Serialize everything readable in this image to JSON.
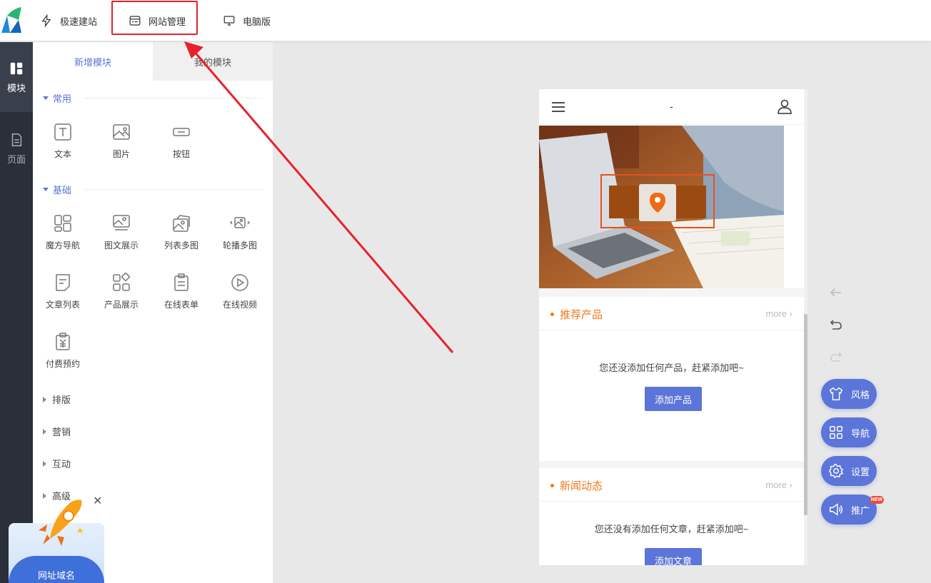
{
  "topbar": {
    "items": [
      {
        "label": "极速建站"
      },
      {
        "label": "网站管理"
      },
      {
        "label": "电脑版"
      }
    ]
  },
  "rail": {
    "items": [
      {
        "label": "模块"
      },
      {
        "label": "页面"
      }
    ]
  },
  "panel": {
    "tabs": [
      {
        "label": "新增模块"
      },
      {
        "label": "我的模块"
      }
    ],
    "sections": [
      {
        "title": "常用",
        "modules": [
          "文本",
          "图片",
          "按钮"
        ]
      },
      {
        "title": "基础",
        "modules": [
          "魔方导航",
          "图文展示",
          "列表多图",
          "轮播多图",
          "文章列表",
          "产品展示",
          "在线表单",
          "在线视频",
          "付费预约"
        ]
      }
    ],
    "collapsed": [
      "排版",
      "营销",
      "互动",
      "高级"
    ]
  },
  "promo": {
    "label": "网址域名"
  },
  "phone": {
    "title": "-",
    "products": {
      "title": "推荐产品",
      "more": "more",
      "empty": "您还没添加任何产品，赶紧添加吧~",
      "button": "添加产品"
    },
    "news": {
      "title": "新闻动态",
      "more": "more",
      "empty": "您还没有添加任何文章，赶紧添加吧~",
      "button": "添加文章"
    }
  },
  "tools": {
    "fabs": [
      {
        "label": "风格"
      },
      {
        "label": "导航"
      },
      {
        "label": "设置"
      },
      {
        "label": "推广"
      }
    ],
    "new_badge": "NEW"
  },
  "colors": {
    "accent": "#5b75d8",
    "orange": "#ee7a1e",
    "highlight": "#e8212a"
  }
}
